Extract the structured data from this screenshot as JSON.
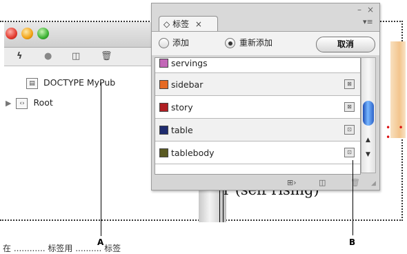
{
  "structure_window": {
    "toolbar_icons": [
      "lightning-icon",
      "dot-icon",
      "new-element-icon",
      "trash-icon"
    ],
    "tree": {
      "doctype": {
        "label": "DOCTYPE MyPub",
        "icon": "doctype-icon"
      },
      "root": {
        "label": "Root",
        "icon": "element-icon"
      }
    }
  },
  "tags_panel": {
    "tab_label": "标签",
    "tab_arrow": "◇",
    "close_glyph": "×",
    "options": {
      "add_label": "添加",
      "retag_label": "重新添加",
      "selected": "retag",
      "cancel_label": "取消"
    },
    "tags": [
      {
        "name": "servings",
        "color": "#c267b7",
        "has_placeholder": false
      },
      {
        "name": "sidebar",
        "color": "#e66a24",
        "has_placeholder": true
      },
      {
        "name": "story",
        "color": "#b01f23",
        "has_placeholder": true
      },
      {
        "name": "table",
        "color": "#1f2c6f",
        "has_placeholder": true
      },
      {
        "name": "tablebody",
        "color": "#5a5a22",
        "has_placeholder": true
      }
    ],
    "footer_icons": [
      "map-styles-icon",
      "new-tag-icon",
      "delete-tag-icon"
    ]
  },
  "document": {
    "text": "r (self rising)",
    "bottom_caption": "在 ............ 标签用 .......... 标签"
  },
  "callouts": {
    "a": "A",
    "b": "B"
  }
}
